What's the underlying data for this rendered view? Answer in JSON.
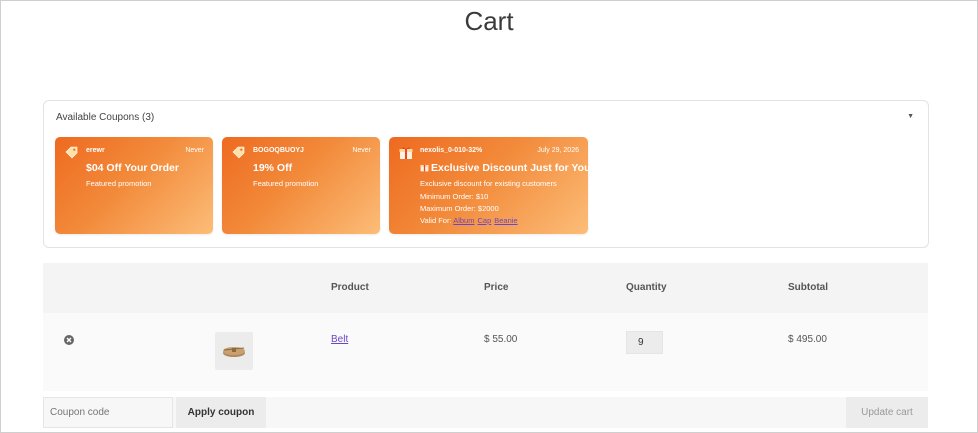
{
  "page": {
    "title": "Cart"
  },
  "coupons": {
    "title": "Available Coupons (3)",
    "toggle_icon": "caret-down-icon",
    "gradient": [
      "#ee6a20",
      "#fcbd78"
    ],
    "items": [
      {
        "code": "erewr",
        "expiry": "Never",
        "heading": "$04 Off Your Order",
        "description": "Featured promotion",
        "icon": "tag-icon"
      },
      {
        "code": "BOGOQBUOYJ",
        "expiry": "Never",
        "heading": "19% Off",
        "description": "Featured promotion",
        "icon": "tag-icon"
      },
      {
        "code": "nexolis_0-010-32%",
        "expiry": "July 29, 2026",
        "heading": "Exclusive Discount Just for You!",
        "description": "Exclusive discount for existing customers",
        "min_order": "Minimum Order: $10",
        "max_order": "Maximum Order: $2000",
        "valid_for_label": "Valid For:",
        "valid_for": [
          "Album",
          "Cap",
          "Beanie"
        ],
        "icon": "gift-icon"
      }
    ]
  },
  "cart": {
    "headers": {
      "product": "Product",
      "price": "Price",
      "quantity": "Quantity",
      "subtotal": "Subtotal"
    },
    "rows": [
      {
        "product": "Belt",
        "price": "$ 55.00",
        "quantity": "9",
        "subtotal": "$ 495.00"
      }
    ]
  },
  "actions": {
    "coupon_placeholder": "Coupon code",
    "apply_label": "Apply coupon",
    "update_label": "Update cart"
  },
  "colors": {
    "link": "#6b47c6",
    "accent": "#ee6a20"
  }
}
